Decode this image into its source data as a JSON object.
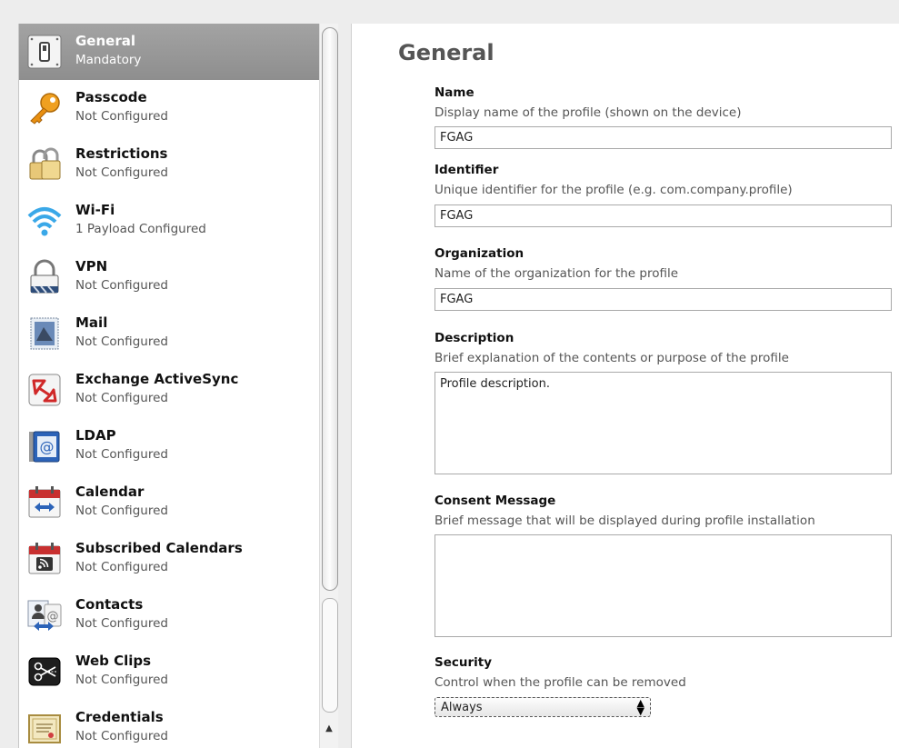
{
  "sidebar": {
    "items": [
      {
        "title": "General",
        "subtitle": "Mandatory",
        "icon": "general-switch-icon",
        "selected": true
      },
      {
        "title": "Passcode",
        "subtitle": "Not Configured",
        "icon": "key-icon"
      },
      {
        "title": "Restrictions",
        "subtitle": "Not Configured",
        "icon": "padlocks-icon"
      },
      {
        "title": "Wi-Fi",
        "subtitle": "1 Payload Configured",
        "icon": "wifi-icon"
      },
      {
        "title": "VPN",
        "subtitle": "Not Configured",
        "icon": "vpn-lock-icon"
      },
      {
        "title": "Mail",
        "subtitle": "Not Configured",
        "icon": "mail-stamp-icon"
      },
      {
        "title": "Exchange ActiveSync",
        "subtitle": "Not Configured",
        "icon": "exchange-icon"
      },
      {
        "title": "LDAP",
        "subtitle": "Not Configured",
        "icon": "ldap-at-icon"
      },
      {
        "title": "Calendar",
        "subtitle": "Not Configured",
        "icon": "calendar-icon"
      },
      {
        "title": "Subscribed Calendars",
        "subtitle": "Not Configured",
        "icon": "subscribed-calendar-icon"
      },
      {
        "title": "Contacts",
        "subtitle": "Not Configured",
        "icon": "contacts-icon"
      },
      {
        "title": "Web Clips",
        "subtitle": "Not Configured",
        "icon": "web-clips-scissors-icon"
      },
      {
        "title": "Credentials",
        "subtitle": "Not Configured",
        "icon": "credentials-certificate-icon"
      }
    ]
  },
  "main": {
    "title": "General",
    "fields": {
      "name": {
        "label": "Name",
        "description": "Display name of the profile (shown on the device)",
        "value": "FGAG"
      },
      "identifier": {
        "label": "Identifier",
        "description": "Unique identifier for the profile (e.g. com.company.profile)",
        "value": "FGAG"
      },
      "organization": {
        "label": "Organization",
        "description": "Name of the organization for the profile",
        "value": "FGAG"
      },
      "description": {
        "label": "Description",
        "description": "Brief explanation of the contents or purpose of the profile",
        "value": "Profile description."
      },
      "consent": {
        "label": "Consent Message",
        "description": "Brief message that will be displayed during profile installation",
        "value": ""
      },
      "security": {
        "label": "Security",
        "description": "Control when the profile can be removed",
        "value": "Always",
        "arrows_glyph": "▲\n▼"
      }
    }
  },
  "scrollbar": {
    "up_arrow": "▲"
  }
}
